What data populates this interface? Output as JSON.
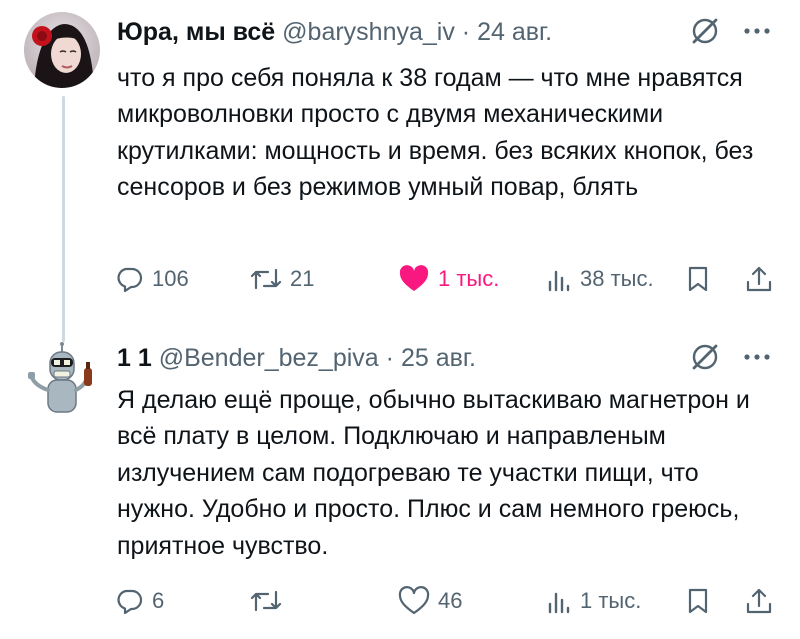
{
  "tweets": [
    {
      "author_name": "Юра, мы всё",
      "handle": "@baryshnya_iv",
      "separator": "·",
      "date": "24 авг.",
      "text": "что я про себя поняла к 38 годам — что мне нравятся микроволновки просто с двумя механическими крутилками: мощность и время. без всяких кнопок, без сенсоров и без режимов умный повар, блять",
      "replies": "106",
      "reposts": "21",
      "likes": "1 тыс.",
      "liked": true,
      "views": "38 тыс.",
      "accent": "#f91880"
    },
    {
      "author_name": "1 1",
      "handle": "@Bender_bez_piva",
      "separator": "·",
      "date": "25 авг.",
      "text": "Я делаю ещё проще, обычно вытаскиваю магнетрон и всё плату в целом. Подключаю и направленым излучением сам подогреваю те участки пищи, что нужно. Удобно и просто. Плюс и сам немного греюсь, приятное чувство.",
      "replies": "6",
      "reposts": "",
      "likes": "46",
      "liked": false,
      "views": "1 тыс."
    }
  ],
  "icons": {
    "reply": "reply-icon",
    "repost": "repost-icon",
    "like": "heart-icon",
    "views": "views-icon",
    "bookmark": "bookmark-icon",
    "share": "share-icon",
    "grok": "grok-icon",
    "more": "more-icon"
  },
  "colors": {
    "text": "#0f1419",
    "muted": "#536471",
    "like": "#f91880",
    "thread_line": "#cfd9de"
  }
}
